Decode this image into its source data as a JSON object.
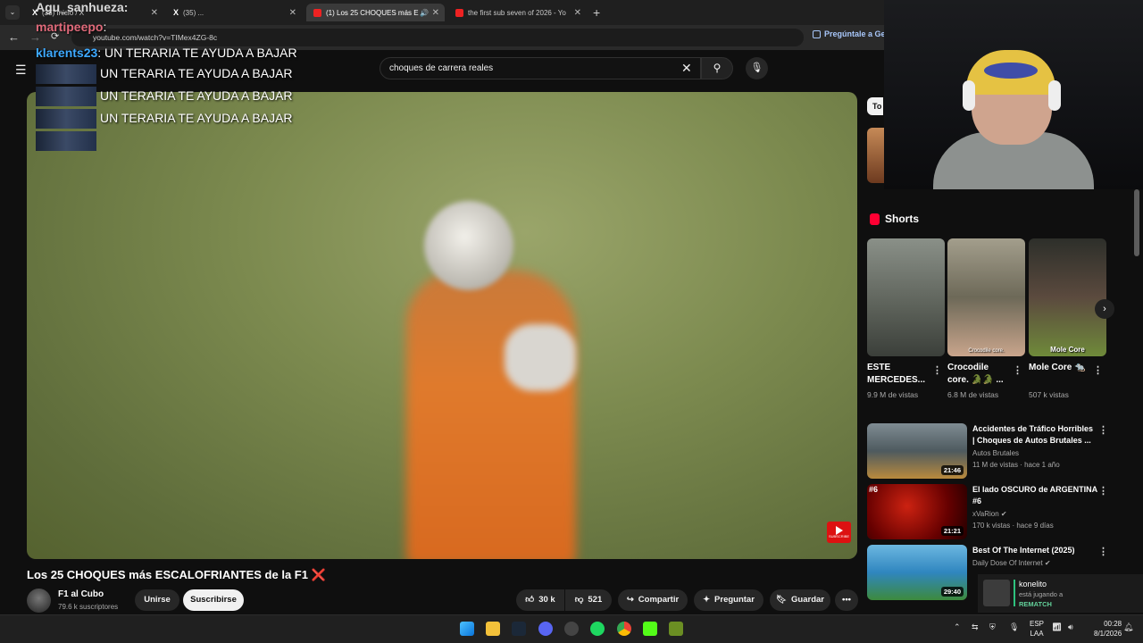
{
  "tabs": [
    {
      "label": "(35) Inicio / X"
    },
    {
      "label": "(35) ..."
    },
    {
      "label": "(1) Los 25 CHOQUES más E"
    },
    {
      "label": "the first sub seven of 2026 - Yo"
    }
  ],
  "address": {
    "url": "youtube.com/watch?v=TIMex4ZG-8c",
    "ask_label": "Pregúntale a Ge"
  },
  "search": {
    "query": "choques de carrera reales"
  },
  "chat": {
    "top_user": "Agu_sanhueza:",
    "lines": [
      {
        "user": "martipeepo",
        "text": ":"
      },
      {
        "user": "klarents23",
        "text": ": UN TERARIA TE AYUDA A BAJAR"
      },
      {
        "user": "",
        "text": "UN TERARIA TE AYUDA A BAJAR"
      },
      {
        "user": "",
        "text": "UN TERARIA TE AYUDA A BAJAR"
      },
      {
        "user": "",
        "text": "UN TERARIA TE AYUDA A BAJAR"
      }
    ]
  },
  "video": {
    "title": "Los 25 CHOQUES más ESCALOFRIANTES de la F1",
    "title_emoji": "❌",
    "watermark": "SUBSCRIBE",
    "channel": "F1 al Cubo",
    "subscribers": "79.6 k suscriptores",
    "join_label": "Unirse",
    "subscribe_label": "Suscribirse",
    "likes": "30 k",
    "dislikes": "521",
    "share_label": "Compartir",
    "ask_label": "Preguntar",
    "save_label": "Guardar",
    "more_label": "•••"
  },
  "sidebar": {
    "chip": "To",
    "shorts_heading": "Shorts",
    "shorts": [
      {
        "title": "ESTE MERCEDES...",
        "views": "9.9 M de vistas",
        "caption": ""
      },
      {
        "title": "Crocodile core. 🐊🐊 ...",
        "views": "6.8 M de vistas",
        "caption": "Crocodile core."
      },
      {
        "title": "Mole Core 🐀",
        "views": "507 k vistas",
        "caption": "Mole Core"
      }
    ],
    "recommended": [
      {
        "rank": "",
        "title": "Accidentes de Tráfico Horribles | Choques de Autos Brutales ...",
        "channel": "Autos Brutales",
        "meta": "11 M de vistas · hace 1 año",
        "duration": "21:46"
      },
      {
        "rank": "#6",
        "title": "El lado OSCURO de ARGENTINA #6",
        "channel": "xVaRion ✔",
        "meta": "170 k vistas · hace 9 días",
        "duration": "21:21"
      },
      {
        "rank": "",
        "title": "Best Of The Internet (2025)",
        "channel": "Daily Dose Of Internet ✔",
        "meta": "",
        "duration": "29:40"
      }
    ]
  },
  "notification": {
    "name": "konelito",
    "status": "está jugando a",
    "game": "REMATCH"
  },
  "taskbar": {
    "lang_top": "ESP",
    "lang_bottom": "LAA",
    "time": "00:28",
    "date": "8/1/2026"
  },
  "colors": {
    "accent_red": "#ff0033",
    "background": "#0f0f0f",
    "notif_green": "#2ec27e"
  }
}
